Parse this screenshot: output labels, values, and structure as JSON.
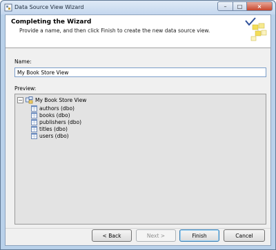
{
  "window": {
    "title": "Data Source View Wizard"
  },
  "header": {
    "title": "Completing the Wizard",
    "subtitle": "Provide a name, and then click Finish to create the new data source view."
  },
  "form": {
    "name_label": "Name:",
    "name_value": "My Book Store View",
    "preview_label": "Preview:"
  },
  "tree": {
    "root": {
      "label": "My Book Store View",
      "expander": "−",
      "icon": "data-source-view-icon"
    },
    "children": [
      {
        "label": "authors (dbo)",
        "icon": "table-icon"
      },
      {
        "label": "books (dbo)",
        "icon": "table-icon"
      },
      {
        "label": "publishers (dbo)",
        "icon": "table-icon"
      },
      {
        "label": "titles (dbo)",
        "icon": "table-icon"
      },
      {
        "label": "users (dbo)",
        "icon": "table-icon"
      }
    ]
  },
  "buttons": {
    "back": "< Back",
    "next": "Next >",
    "finish": "Finish",
    "cancel": "Cancel"
  },
  "colors": {
    "title_bar": "#c4d7ee",
    "panel_bg": "#f0f0f0",
    "preview_bg": "#e3e3e3",
    "close_button": "#c7462d",
    "input_border": "#7a9cc8"
  }
}
